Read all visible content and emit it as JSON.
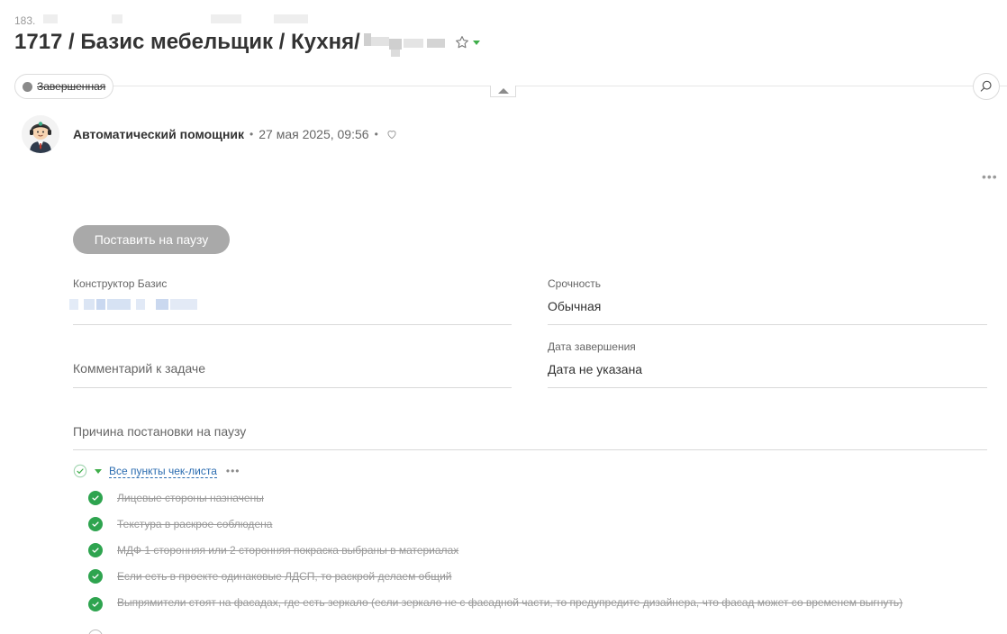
{
  "task": {
    "number": "183.",
    "title": "1717 / Базис мебельщик / Кухня/"
  },
  "status": {
    "label": "Завершенная"
  },
  "comment": {
    "author": "Автоматический помощник",
    "separator": "•",
    "date": "27 мая 2025, 09:56"
  },
  "actions": {
    "pause_button": "Поставить на паузу",
    "more": "•••"
  },
  "fields": {
    "constructor_label": "Конструктор Базис",
    "urgency_label": "Срочность",
    "urgency_value": "Обычная",
    "comment_placeholder": "Комментарий к задаче",
    "end_date_label": "Дата завершения",
    "end_date_value": "Дата не указана",
    "pause_reason_placeholder": "Причина постановки на паузу"
  },
  "checklist": {
    "title": "Все пункты чек-листа",
    "more": "•••",
    "items": [
      {
        "text": "Лицевые стороны назначены",
        "done": true
      },
      {
        "text": "Текстура в раскрое соблюдена",
        "done": true
      },
      {
        "text": "МДФ 1 сторонняя или 2 сторонняя покраска выбраны в материалах",
        "done": true
      },
      {
        "text": "Если есть в проекте одинаковые ЛДСП, то раскрой делаем общий",
        "done": true
      },
      {
        "text": "Выпрямители стоят на фасадах, где есть зеркало (если зеркало не с фасадной части, то предупредите дизайнера, что фасад может со временем выгнуть)",
        "done": true
      }
    ]
  },
  "icons": {
    "star": "star-icon",
    "search": "search-icon",
    "heart": "heart-icon",
    "check": "check-icon"
  },
  "colors": {
    "accent_green": "#2ea44f",
    "link_blue": "#2b6cb0",
    "pause_button_bg": "#a9a9a9"
  }
}
